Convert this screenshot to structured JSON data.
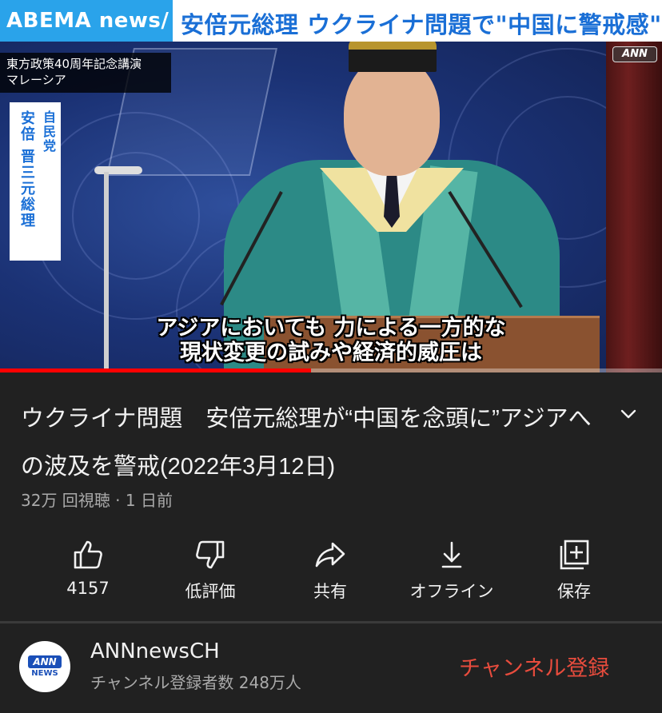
{
  "player": {
    "logo": "ABEMA news/",
    "headline": "安倍元総理 ウクライナ問題で\"中国に警戒感\"",
    "watermark": "ANN",
    "location_line1": "東方政策40周年記念講演",
    "location_line2": "マレーシア",
    "name_party": "自民党",
    "name_person": "安倍 晋三元総理",
    "subtitle_line1": "アジアにおいても 力による一方的な",
    "subtitle_line2": "現状変更の試みや経済的威圧は",
    "progress": 0.47,
    "progress_color": "#ff0000"
  },
  "video": {
    "title": "ウクライナ問題　安倍元総理が“中国を念頭に”アジアへの波及を警戒(2022年3月12日)",
    "meta": "32万 回視聴 · 1 日前",
    "expand_icon": "chevron-down-icon"
  },
  "actions": {
    "like": {
      "icon": "thumbs-up-icon",
      "label": "4157"
    },
    "dislike": {
      "icon": "thumbs-down-icon",
      "label": "低評価"
    },
    "share": {
      "icon": "share-arrow-icon",
      "label": "共有"
    },
    "offline": {
      "icon": "download-icon",
      "label": "オフライン"
    },
    "save": {
      "icon": "add-to-playlist-icon",
      "label": "保存"
    }
  },
  "channel": {
    "avatar_top": "ANN",
    "avatar_bottom": "NEWS",
    "name": "ANNnewsCH",
    "subscribers": "チャンネル登録者数 248万人",
    "subscribe_label": "チャンネル登録",
    "subscribe_color": "#e84c3d"
  }
}
